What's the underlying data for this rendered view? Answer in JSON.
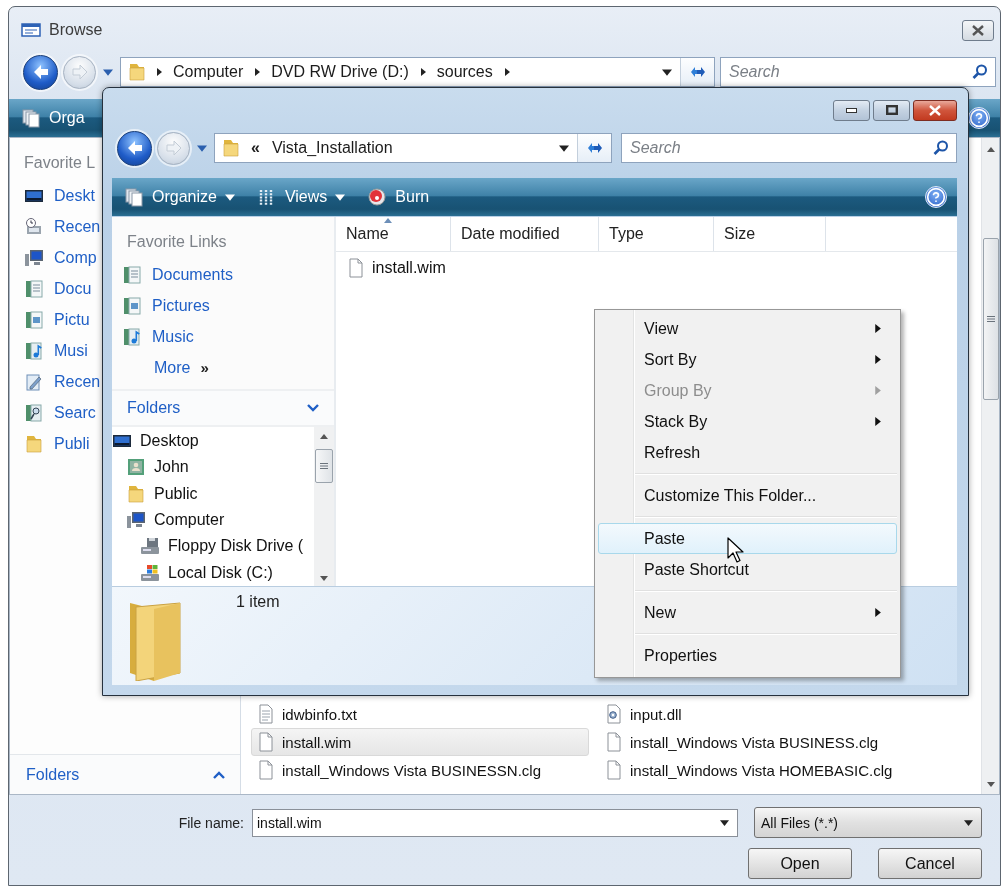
{
  "browse_dialog": {
    "title": "Browse",
    "address": {
      "crumbs": [
        "Computer",
        "DVD RW Drive (D:)",
        "sources"
      ]
    },
    "search": {
      "placeholder": "Search"
    },
    "toolbar": [
      {
        "label": "Orga",
        "kind": "organize"
      }
    ],
    "favorite_links": {
      "heading": "Favorite L",
      "items": [
        {
          "label": "Deskt",
          "kind": "desktop"
        },
        {
          "label": "Recen",
          "kind": "recent"
        },
        {
          "label": "Comp",
          "kind": "computer"
        },
        {
          "label": "Docu",
          "kind": "documents"
        },
        {
          "label": "Pictu",
          "kind": "pictures"
        },
        {
          "label": "Musi",
          "kind": "music"
        },
        {
          "label": "Recen",
          "kind": "changed"
        },
        {
          "label": "Searc",
          "kind": "searches"
        },
        {
          "label": "Publi",
          "kind": "folder"
        }
      ]
    },
    "folders": {
      "label": "Folders",
      "expanded": false
    },
    "files": [
      {
        "name": "idwbinfo.txt",
        "kind": "text",
        "selected": false
      },
      {
        "name": "input.dll",
        "kind": "dll",
        "selected": false
      },
      {
        "name": "install.wim",
        "kind": "file",
        "selected": true
      },
      {
        "name": "install_Windows Vista BUSINESS.clg",
        "kind": "file",
        "selected": false
      },
      {
        "name": "install_Windows Vista BUSINESSN.clg",
        "kind": "file",
        "selected": false
      },
      {
        "name": "install_Windows Vista HOMEBASIC.clg",
        "kind": "file",
        "selected": false
      }
    ],
    "file_name": {
      "label": "File name:",
      "value": "install.wim"
    },
    "file_type": {
      "value": "All Files (*.*)"
    },
    "buttons": [
      "Open",
      "Cancel"
    ]
  },
  "explorer_window": {
    "address": {
      "prefix": "«",
      "location": "Vista_Installation"
    },
    "search": {
      "placeholder": "Search"
    },
    "toolbar": [
      {
        "label": "Organize",
        "kind": "organize",
        "dropdown": true
      },
      {
        "label": "Views",
        "kind": "views",
        "dropdown": true
      },
      {
        "label": "Burn",
        "kind": "burn",
        "dropdown": false
      }
    ],
    "favorite_links": {
      "heading": "Favorite Links",
      "items": [
        {
          "label": "Documents",
          "kind": "documents"
        },
        {
          "label": "Pictures",
          "kind": "pictures"
        },
        {
          "label": "Music",
          "kind": "music"
        }
      ],
      "more": {
        "label": "More",
        "glyph": "»"
      }
    },
    "folders": {
      "label": "Folders",
      "expanded": true
    },
    "tree": [
      {
        "label": "Desktop",
        "kind": "desktop",
        "children": [
          {
            "label": "John",
            "kind": "user"
          },
          {
            "label": "Public",
            "kind": "folder"
          },
          {
            "label": "Computer",
            "kind": "computer",
            "children": [
              {
                "label": "Floppy Disk Drive (",
                "kind": "floppy"
              },
              {
                "label": "Local Disk (C:)",
                "kind": "disk"
              }
            ]
          }
        ]
      }
    ],
    "columns": [
      {
        "label": "Name",
        "sorted": true
      },
      {
        "label": "Date modified",
        "sorted": false
      },
      {
        "label": "Type",
        "sorted": false
      },
      {
        "label": "Size",
        "sorted": false
      }
    ],
    "files": [
      {
        "name": "install.wim",
        "kind": "file"
      }
    ],
    "details": {
      "count": "1 item"
    }
  },
  "context_menu": {
    "items": [
      {
        "kind": "item",
        "label": "View",
        "submenu": true,
        "disabled": false,
        "highlighted": false
      },
      {
        "kind": "item",
        "label": "Sort By",
        "submenu": true,
        "disabled": false,
        "highlighted": false
      },
      {
        "kind": "item",
        "label": "Group By",
        "submenu": true,
        "disabled": true,
        "highlighted": false
      },
      {
        "kind": "item",
        "label": "Stack By",
        "submenu": true,
        "disabled": false,
        "highlighted": false
      },
      {
        "kind": "item",
        "label": "Refresh",
        "submenu": false,
        "disabled": false,
        "highlighted": false
      },
      {
        "kind": "separator"
      },
      {
        "kind": "item",
        "label": "Customize This Folder...",
        "submenu": false,
        "disabled": false,
        "highlighted": false
      },
      {
        "kind": "separator"
      },
      {
        "kind": "item",
        "label": "Paste",
        "submenu": false,
        "disabled": false,
        "highlighted": true
      },
      {
        "kind": "item",
        "label": "Paste Shortcut",
        "submenu": false,
        "disabled": false,
        "highlighted": false
      },
      {
        "kind": "separator"
      },
      {
        "kind": "item",
        "label": "New",
        "submenu": true,
        "disabled": false,
        "highlighted": false
      },
      {
        "kind": "separator"
      },
      {
        "kind": "item",
        "label": "Properties",
        "submenu": false,
        "disabled": false,
        "highlighted": false
      }
    ]
  }
}
